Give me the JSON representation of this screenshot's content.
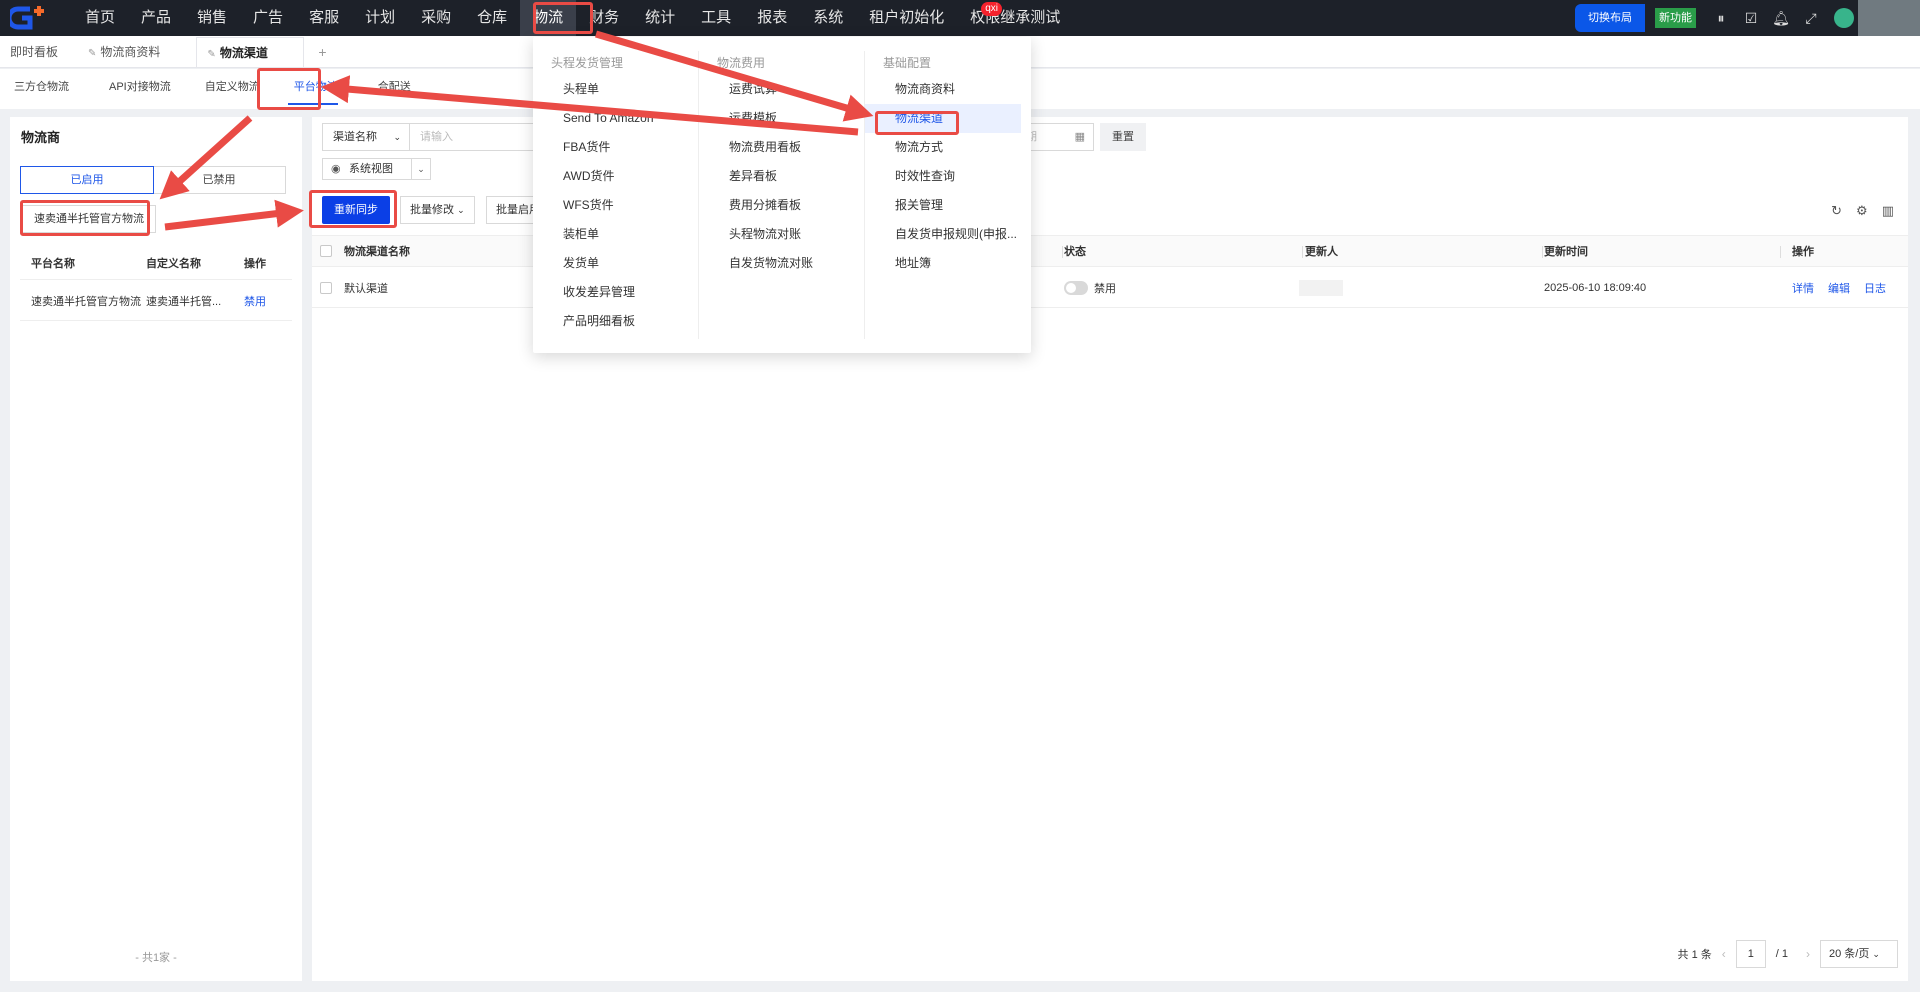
{
  "topnav": {
    "items": [
      "首页",
      "产品",
      "销售",
      "广告",
      "客服",
      "计划",
      "采购",
      "仓库",
      "物流",
      "财务",
      "统计",
      "工具",
      "报表",
      "系统",
      "租户初始化",
      "权限继承测试"
    ],
    "active_index": 8,
    "badge_text": "qxi",
    "switch_layout": "切换布局",
    "new_feature": "新功能"
  },
  "page_tabs": {
    "tab1": "即时看板",
    "tab2": "物流商资料",
    "tab3": "物流渠道",
    "add": "+"
  },
  "sub_tabs": [
    "三方仓物流",
    "API对接物流",
    "自定义物流",
    "平台物流",
    "合配送"
  ],
  "left": {
    "title": "物流商",
    "seg_enabled": "已启用",
    "seg_disabled": "已禁用",
    "chip": "速卖通半托管官方物流",
    "head": {
      "c1": "平台名称",
      "c2": "自定义名称",
      "c3": "操作"
    },
    "row": {
      "c1": "速卖通半托管官方物流",
      "c2": "速卖通半托管...",
      "c3": "禁用"
    },
    "total": "- 共1家 -"
  },
  "right": {
    "filter_select": "渠道名称",
    "filter_placeholder": "请输入",
    "date_placeholder": "日期",
    "reset": "重置",
    "view": "系统视图",
    "sync": "重新同步",
    "batch_edit": "批量修改",
    "batch_enable": "批量启用",
    "table": {
      "headers": {
        "name": "物流渠道名称",
        "status": "状态",
        "updater": "更新人",
        "time": "更新时间",
        "ops": "操作"
      },
      "row": {
        "name": "默认渠道",
        "status": "禁用",
        "time": "2025-06-10 18:09:40",
        "op1": "详情",
        "op2": "编辑",
        "op3": "日志"
      }
    },
    "pager": {
      "total": "共 1 条",
      "page": "1",
      "pages": "/ 1",
      "size": "20 条/页"
    }
  },
  "megamenu": {
    "col1": {
      "title": "头程发货管理",
      "items": [
        "头程单",
        "Send To Amazon",
        "FBA货件",
        "AWD货件",
        "WFS货件",
        "装柜单",
        "发货单",
        "收发差异管理",
        "产品明细看板"
      ]
    },
    "col2": {
      "title": "物流费用",
      "items": [
        "运费试算",
        "运费模板",
        "物流费用看板",
        "差异看板",
        "费用分摊看板",
        "头程物流对账",
        "自发货物流对账"
      ]
    },
    "col3": {
      "title": "基础配置",
      "items": [
        "物流商资料",
        "物流渠道",
        "物流方式",
        "时效性查询",
        "报关管理",
        "自发货申报规则(申报...",
        "地址簿"
      ]
    }
  },
  "colors": {
    "accent": "#1f57e8",
    "annotation": "#e94b45",
    "nav_bg": "#1d2129"
  }
}
